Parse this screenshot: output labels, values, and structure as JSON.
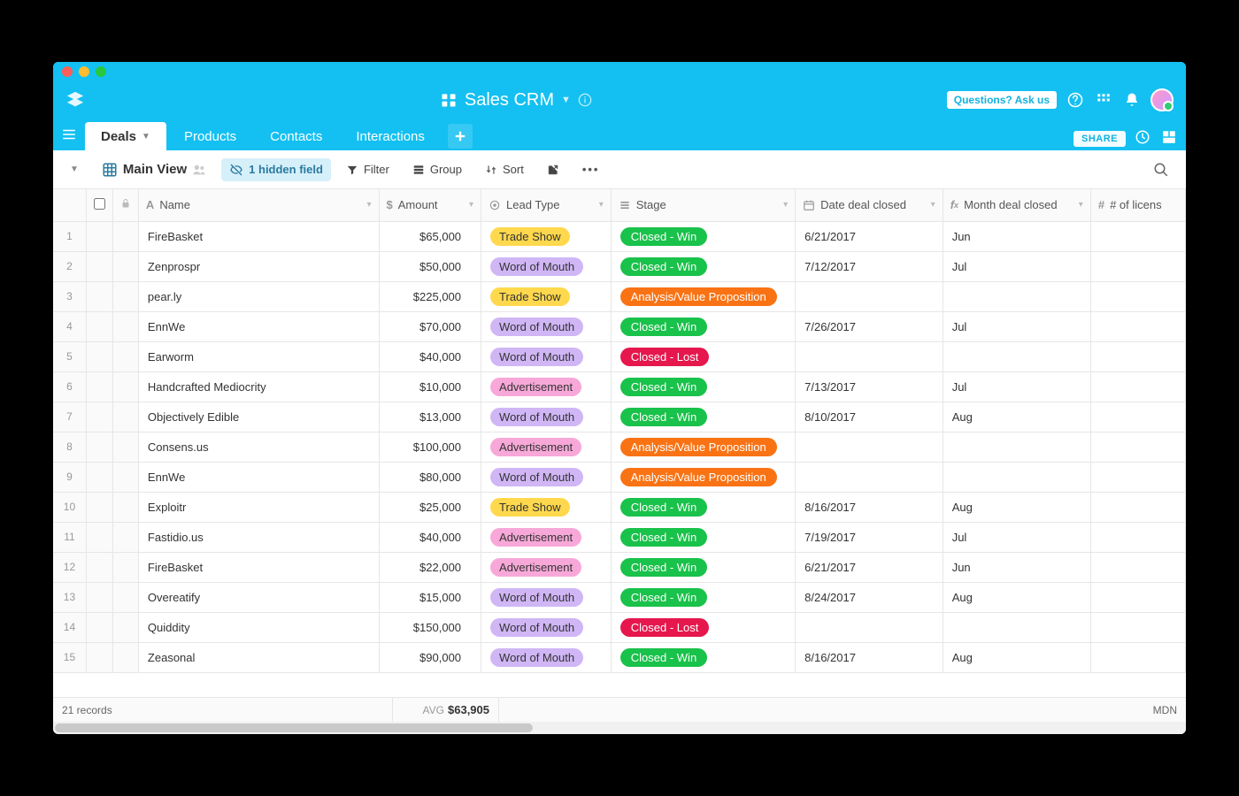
{
  "app": {
    "title": "Sales CRM"
  },
  "topbar": {
    "ask_label": "Questions? Ask us"
  },
  "tabs": {
    "items": [
      "Deals",
      "Products",
      "Contacts",
      "Interactions"
    ],
    "active_index": 0,
    "share_label": "SHARE"
  },
  "toolbar": {
    "view_name": "Main View",
    "hidden_fields": "1 hidden field",
    "filter": "Filter",
    "group": "Group",
    "sort": "Sort"
  },
  "columns": {
    "name": "Name",
    "amount": "Amount",
    "lead_type": "Lead Type",
    "stage": "Stage",
    "date_closed": "Date deal closed",
    "month_closed": "Month deal closed",
    "licenses": "# of licens"
  },
  "lead_colors": {
    "Trade Show": "trade",
    "Word of Mouth": "word",
    "Advertisement": "ad"
  },
  "stage_colors": {
    "Closed - Win": "win",
    "Closed - Lost": "lost",
    "Analysis/Value Proposition": "avp"
  },
  "rows": [
    {
      "name": "FireBasket",
      "amount": "$65,000",
      "lead": "Trade Show",
      "stage": "Closed - Win",
      "date": "6/21/2017",
      "month": "Jun"
    },
    {
      "name": "Zenprospr",
      "amount": "$50,000",
      "lead": "Word of Mouth",
      "stage": "Closed - Win",
      "date": "7/12/2017",
      "month": "Jul"
    },
    {
      "name": "pear.ly",
      "amount": "$225,000",
      "lead": "Trade Show",
      "stage": "Analysis/Value Proposition",
      "date": "",
      "month": ""
    },
    {
      "name": "EnnWe",
      "amount": "$70,000",
      "lead": "Word of Mouth",
      "stage": "Closed - Win",
      "date": "7/26/2017",
      "month": "Jul"
    },
    {
      "name": "Earworm",
      "amount": "$40,000",
      "lead": "Word of Mouth",
      "stage": "Closed - Lost",
      "date": "",
      "month": ""
    },
    {
      "name": "Handcrafted Mediocrity",
      "amount": "$10,000",
      "lead": "Advertisement",
      "stage": "Closed - Win",
      "date": "7/13/2017",
      "month": "Jul"
    },
    {
      "name": "Objectively Edible",
      "amount": "$13,000",
      "lead": "Word of Mouth",
      "stage": "Closed - Win",
      "date": "8/10/2017",
      "month": "Aug"
    },
    {
      "name": "Consens.us",
      "amount": "$100,000",
      "lead": "Advertisement",
      "stage": "Analysis/Value Proposition",
      "date": "",
      "month": ""
    },
    {
      "name": "EnnWe",
      "amount": "$80,000",
      "lead": "Word of Mouth",
      "stage": "Analysis/Value Proposition",
      "date": "",
      "month": ""
    },
    {
      "name": "Exploitr",
      "amount": "$25,000",
      "lead": "Trade Show",
      "stage": "Closed - Win",
      "date": "8/16/2017",
      "month": "Aug"
    },
    {
      "name": "Fastidio.us",
      "amount": "$40,000",
      "lead": "Advertisement",
      "stage": "Closed - Win",
      "date": "7/19/2017",
      "month": "Jul"
    },
    {
      "name": "FireBasket",
      "amount": "$22,000",
      "lead": "Advertisement",
      "stage": "Closed - Win",
      "date": "6/21/2017",
      "month": "Jun"
    },
    {
      "name": "Overeatify",
      "amount": "$15,000",
      "lead": "Word of Mouth",
      "stage": "Closed - Win",
      "date": "8/24/2017",
      "month": "Aug"
    },
    {
      "name": "Quiddity",
      "amount": "$150,000",
      "lead": "Word of Mouth",
      "stage": "Closed - Lost",
      "date": "",
      "month": ""
    },
    {
      "name": "Zeasonal",
      "amount": "$90,000",
      "lead": "Word of Mouth",
      "stage": "Closed - Win",
      "date": "8/16/2017",
      "month": "Aug"
    }
  ],
  "summary": {
    "record_count": "21 records",
    "avg_label": "AVG",
    "avg_value": "$63,905",
    "right_label": "MDN"
  }
}
